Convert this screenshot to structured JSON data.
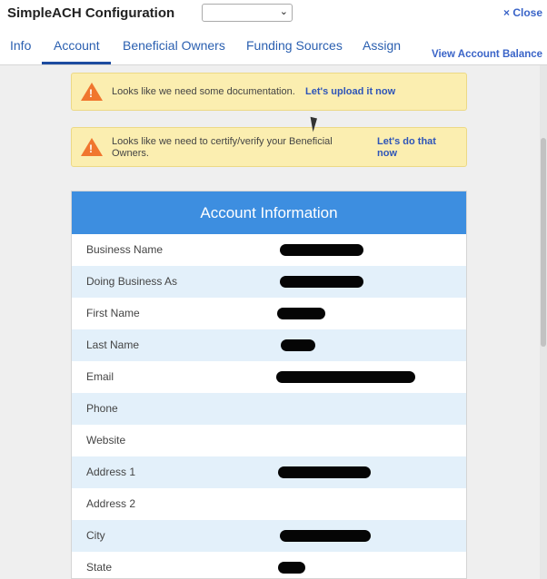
{
  "app": {
    "title": "SimpleACH Configuration",
    "close_label": "× Close",
    "select_value": ""
  },
  "tabs": [
    {
      "label": "Info",
      "active": false
    },
    {
      "label": "Account",
      "active": true
    },
    {
      "label": "Beneficial Owners",
      "active": false
    },
    {
      "label": "Funding Sources",
      "active": false
    },
    {
      "label": "Assign",
      "active": false
    }
  ],
  "header_link": "View Account Balance",
  "alerts": [
    {
      "text": "Looks like we need some documentation.",
      "link": "Let's upload it now"
    },
    {
      "text": "Looks like we need to certify/verify your Beneficial Owners.",
      "link": "Let's do that now"
    }
  ],
  "panel": {
    "title": "Account Information",
    "rows": [
      {
        "label": "Business Name",
        "redacted": true
      },
      {
        "label": "Doing Business As",
        "redacted": true
      },
      {
        "label": "First Name",
        "redacted": true
      },
      {
        "label": "Last Name",
        "redacted": true
      },
      {
        "label": "Email",
        "redacted": true
      },
      {
        "label": "Phone",
        "redacted": false
      },
      {
        "label": "Website",
        "redacted": false
      },
      {
        "label": "Address 1",
        "redacted": true
      },
      {
        "label": "Address 2",
        "redacted": false
      },
      {
        "label": "City",
        "redacted": true
      },
      {
        "label": "State",
        "redacted": true
      }
    ]
  },
  "colors": {
    "header_blue": "#3d8ee0",
    "link_blue": "#3a64c8",
    "alert_yellow": "#fbeeb0",
    "warning_orange": "#f0762e",
    "alt_row": "#e3f0fa"
  }
}
